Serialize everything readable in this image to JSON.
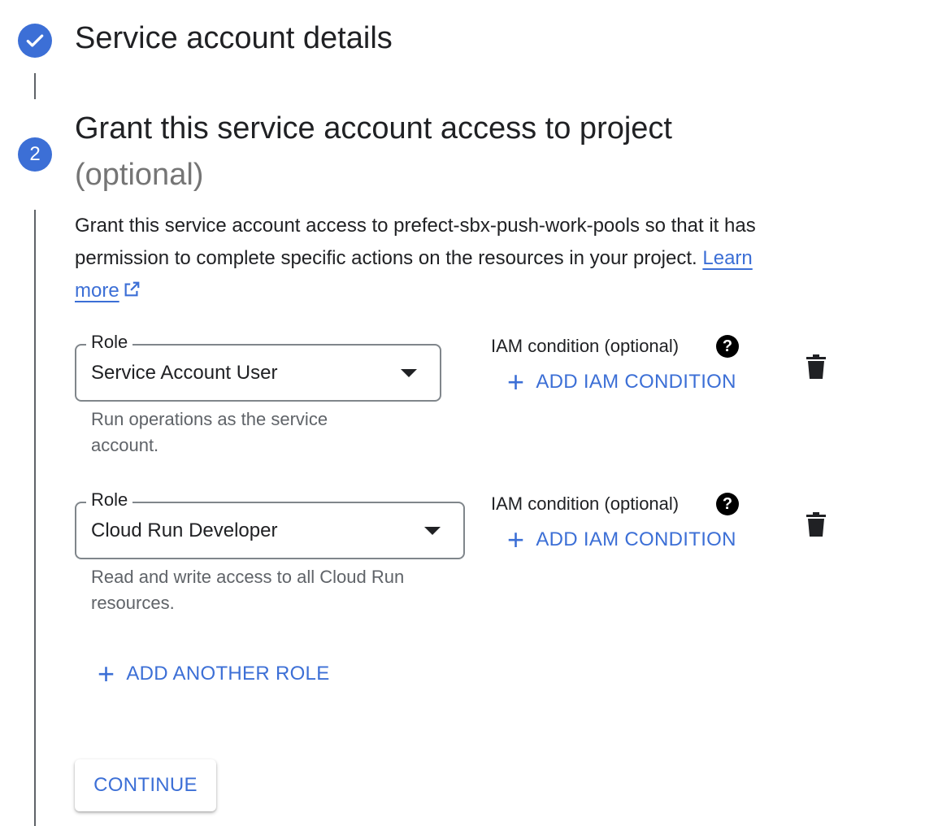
{
  "steps": [
    {
      "title": "Service account details",
      "status": "complete"
    },
    {
      "number": "2",
      "title": "Grant this service account access to project",
      "optional_label": "(optional)"
    }
  ],
  "description": {
    "text": "Grant this service account access to prefect-sbx-push-work-pools so that it has permission to complete specific actions on the resources in your project.",
    "link_label_1": "Learn",
    "link_label_2": "more"
  },
  "roles": [
    {
      "field_label": "Role",
      "value": "Service Account User",
      "hint": "Run operations as the service account.",
      "iam_label": "IAM condition (optional)",
      "add_condition_label": "ADD IAM CONDITION"
    },
    {
      "field_label": "Role",
      "value": "Cloud Run Developer",
      "hint": "Read and write access to all Cloud Run resources.",
      "iam_label": "IAM condition (optional)",
      "add_condition_label": "ADD IAM CONDITION"
    }
  ],
  "add_role_label": "ADD ANOTHER ROLE",
  "continue_label": "CONTINUE",
  "colors": {
    "accent": "#3c6fd6",
    "text": "#202124",
    "muted": "#5f6368"
  },
  "icons": {
    "check": "check-icon",
    "external": "external-link-icon",
    "help": "help-icon",
    "delete": "trash-icon",
    "add": "plus-icon"
  }
}
